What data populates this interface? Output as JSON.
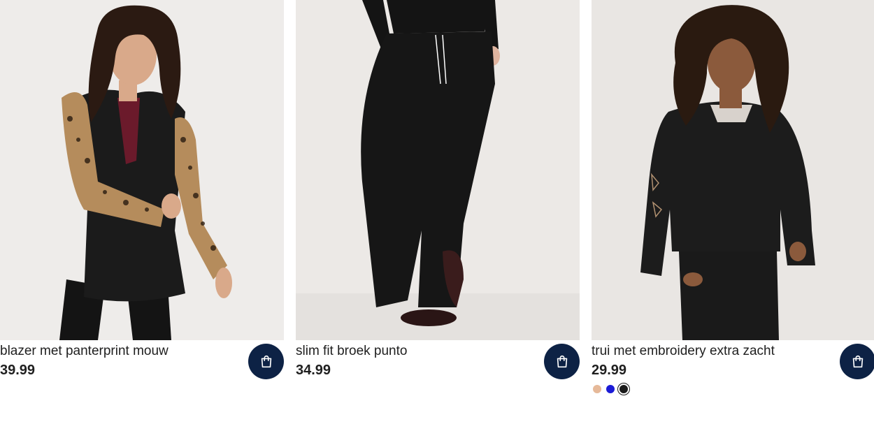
{
  "products": [
    {
      "title": "blazer met panterprint mouw",
      "price": "39.99",
      "cart_icon": "shopping-bag-icon"
    },
    {
      "title": "slim fit broek punto",
      "price": "34.99",
      "cart_icon": "shopping-bag-icon"
    },
    {
      "title": "trui met embroidery extra zacht",
      "price": "29.99",
      "cart_icon": "shopping-bag-icon",
      "swatches": [
        {
          "color": "#e6b999",
          "selected": false
        },
        {
          "color": "#1b1bd6",
          "selected": false
        },
        {
          "color": "#1a1a1a",
          "selected": true
        }
      ]
    }
  ],
  "colors": {
    "cart_button": "#0d2245",
    "text": "#1f1f1f",
    "background": "#ffffff"
  }
}
